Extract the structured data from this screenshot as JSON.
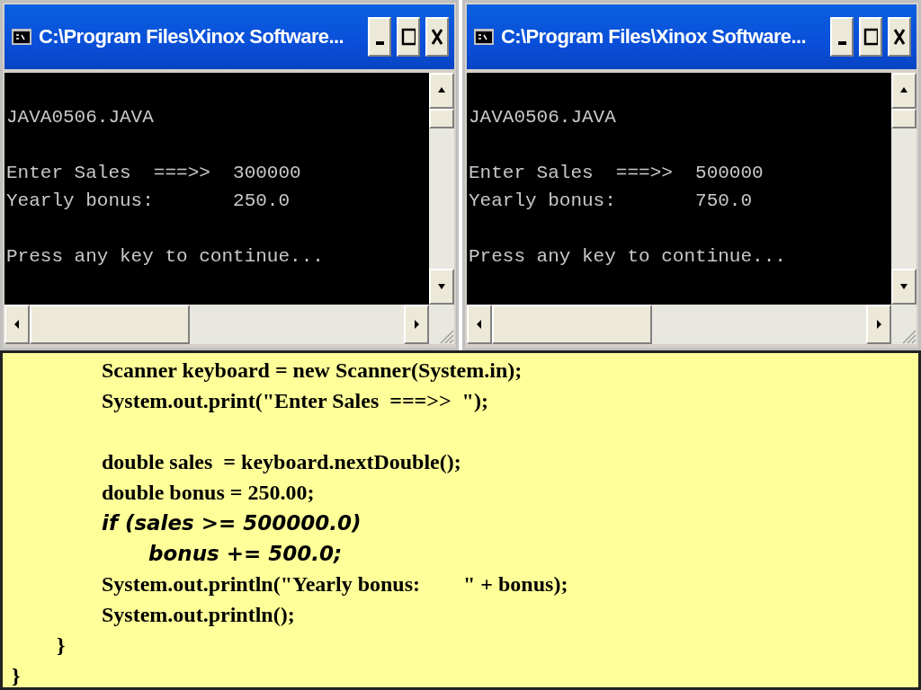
{
  "windows": [
    {
      "title": "C:\\Program Files\\Xinox Software...",
      "output": [
        [
          "JAVA0506.JAVA"
        ],
        [
          "Enter Sales  ===>>  300000",
          "Yearly bonus:       250.0"
        ],
        [
          "Press any key to continue..."
        ]
      ]
    },
    {
      "title": "C:\\Program Files\\Xinox Software...",
      "output": [
        [
          "JAVA0506.JAVA"
        ],
        [
          "Enter Sales  ===>>  500000",
          "Yearly bonus:       750.0"
        ],
        [
          "Press any key to continue..."
        ]
      ]
    }
  ],
  "code": [
    {
      "kind": "statement",
      "text": "Scanner keyboard = new Scanner(System.in);"
    },
    {
      "kind": "statement",
      "text": "System.out.print(\"Enter Sales  ===>>  \");"
    },
    {
      "kind": "statement-after-gap",
      "text": "double sales  = keyboard.nextDouble();"
    },
    {
      "kind": "statement",
      "text": "double bonus = 250.00;"
    },
    {
      "kind": "highlight",
      "text": "if (sales >= 500000.0)"
    },
    {
      "kind": "highlight-nested",
      "text": "bonus += 500.0;"
    },
    {
      "kind": "statement",
      "text": "System.out.println(\"Yearly bonus:        \" + bonus);"
    },
    {
      "kind": "statement",
      "text": "System.out.println();"
    },
    {
      "kind": "method-close",
      "text": "}"
    },
    {
      "kind": "class-close",
      "text": "}"
    }
  ]
}
